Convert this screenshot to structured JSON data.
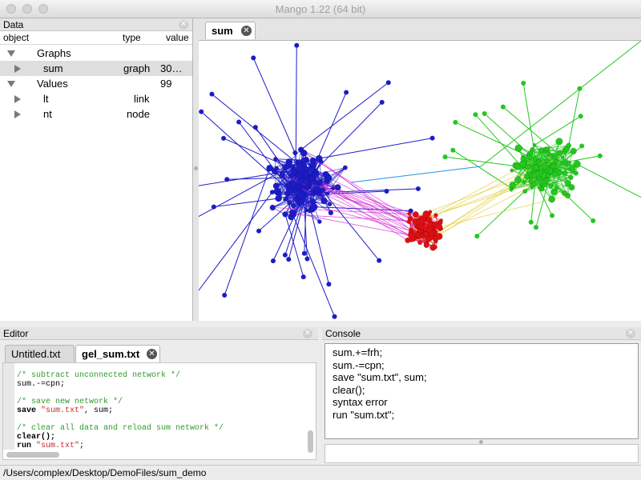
{
  "window": {
    "title": "Mango 1.22 (64 bit)"
  },
  "data_panel": {
    "title": "Data",
    "columns": [
      "object",
      "type",
      "value"
    ],
    "rows": [
      {
        "name": "Graphs",
        "type": "",
        "value": ""
      },
      {
        "name": "sum",
        "type": "graph",
        "value": "30…99"
      },
      {
        "name": "Values",
        "type": "",
        "value": ""
      },
      {
        "name": "lt",
        "type": "link",
        "value": ""
      },
      {
        "name": "nt",
        "type": "node",
        "value": ""
      }
    ]
  },
  "graph_view": {
    "tab_label": "sum"
  },
  "editor": {
    "title": "Editor",
    "tabs": [
      "Untitled.txt",
      "gel_sum.txt"
    ],
    "code": {
      "c1": "/* subtract unconnected network */",
      "l1": "sum.-=cpn;",
      "c2": "/* save new network */",
      "l2_kw": "save",
      "l2_str": "\"sum.txt\"",
      "l2_rest": ", sum;",
      "c3": "/* clear all data and reload sum network */",
      "l3": "clear();",
      "l4_kw": "run",
      "l4_str": "\"sum.txt\"",
      "l4_rest": ";"
    }
  },
  "console": {
    "title": "Console",
    "lines": [
      "sum.+=frh;",
      "sum.-=cpn;",
      "save \"sum.txt\", sum;",
      "clear();",
      "syntax error",
      "run \"sum.txt\";"
    ]
  },
  "status_bar": {
    "path": "/Users/complex/Desktop/DemoFiles/sum_demo"
  },
  "colors": {
    "cluster_blue": "#1c1cc8",
    "cluster_red": "#e01010",
    "cluster_green": "#22c81e",
    "cross_link_cyan": "#1e96e6",
    "cross_link_magenta": "#d21ed2"
  }
}
